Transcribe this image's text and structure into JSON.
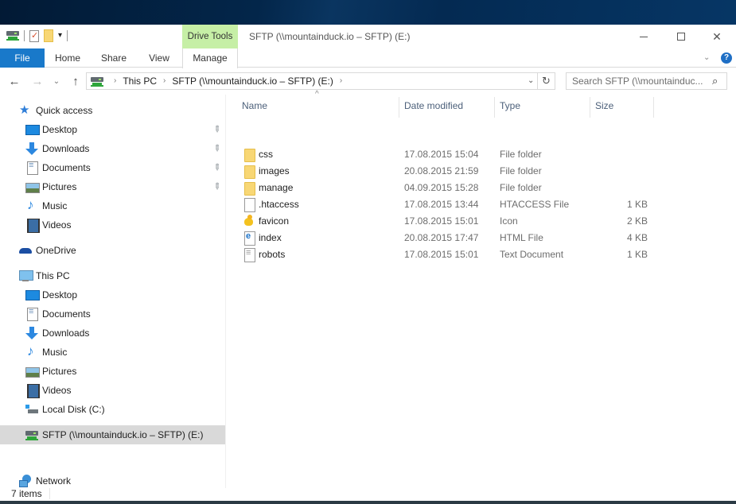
{
  "window": {
    "title": "SFTP (\\\\mountainduck.io – SFTP) (E:)",
    "context_tool_tab": "Drive Tools",
    "controls": {
      "minimize": "—",
      "maximize": "☐",
      "close": "✕"
    }
  },
  "quick_access_toolbar": {
    "icons": [
      "drive-icon",
      "properties-icon",
      "new-folder-icon"
    ],
    "dropdown_glyph": "▾"
  },
  "ribbon": {
    "tabs": [
      {
        "label": "File",
        "active": true
      },
      {
        "label": "Home"
      },
      {
        "label": "Share"
      },
      {
        "label": "View"
      },
      {
        "label": "Manage"
      }
    ],
    "expand_glyph": "⌄",
    "help_glyph": "?"
  },
  "navigation": {
    "back_glyph": "←",
    "forward_glyph": "→",
    "recent_glyph": "⌄",
    "up_glyph": "↑",
    "breadcrumb": [
      "This PC",
      "SFTP (\\\\mountainduck.io – SFTP) (E:)"
    ],
    "crumb_separator": "›",
    "dropdown_glyph": "⌄",
    "refresh_glyph": "↻",
    "search_placeholder": "Search SFTP (\\\\mountainduc...",
    "search_glyph": "⚲"
  },
  "sidebar": {
    "pin_glyph": "📌",
    "items": [
      {
        "label": "Quick access",
        "icon": "quick-access-star-icon"
      },
      {
        "label": "Desktop",
        "icon": "desktop-icon",
        "pinned": true
      },
      {
        "label": "Downloads",
        "icon": "downloads-icon",
        "pinned": true
      },
      {
        "label": "Documents",
        "icon": "documents-icon",
        "pinned": true
      },
      {
        "label": "Pictures",
        "icon": "pictures-icon",
        "pinned": true
      },
      {
        "label": "Music",
        "icon": "music-icon"
      },
      {
        "label": "Videos",
        "icon": "videos-icon"
      },
      {
        "label": "OneDrive",
        "icon": "onedrive-icon"
      },
      {
        "label": "This PC",
        "icon": "this-pc-icon"
      },
      {
        "label": "Desktop",
        "icon": "desktop-icon"
      },
      {
        "label": "Documents",
        "icon": "documents-icon"
      },
      {
        "label": "Downloads",
        "icon": "downloads-icon"
      },
      {
        "label": "Music",
        "icon": "music-icon"
      },
      {
        "label": "Pictures",
        "icon": "pictures-icon"
      },
      {
        "label": "Videos",
        "icon": "videos-icon"
      },
      {
        "label": "Local Disk (C:)",
        "icon": "local-disk-icon"
      },
      {
        "label": "SFTP (\\\\mountainduck.io – SFTP) (E:)",
        "icon": "sftp-drive-icon",
        "selected": true
      },
      {
        "label": "Network",
        "icon": "network-icon"
      }
    ]
  },
  "file_list": {
    "columns": [
      "Name",
      "Date modified",
      "Type",
      "Size"
    ],
    "sort_glyph": "^",
    "rows": [
      {
        "name": "css",
        "date": "17.08.2015 15:04",
        "type": "File folder",
        "size": ""
      },
      {
        "name": "images",
        "date": "20.08.2015 21:59",
        "type": "File folder",
        "size": ""
      },
      {
        "name": "manage",
        "date": "04.09.2015 15:28",
        "type": "File folder",
        "size": ""
      },
      {
        "name": ".htaccess",
        "date": "17.08.2015 13:44",
        "type": "HTACCESS File",
        "size": "1 KB"
      },
      {
        "name": "favicon",
        "date": "17.08.2015 15:01",
        "type": "Icon",
        "size": "2 KB"
      },
      {
        "name": "index",
        "date": "20.08.2015 17:47",
        "type": "HTML File",
        "size": "4 KB"
      },
      {
        "name": "robots",
        "date": "17.08.2015 15:01",
        "type": "Text Document",
        "size": "1 KB"
      }
    ]
  },
  "status": {
    "item_count": "7 items"
  },
  "colors": {
    "file_tab": "#1979ca",
    "context_tab": "#c6efa6",
    "selected_nav": "#d9d9d9",
    "header_text": "#4c607a"
  }
}
